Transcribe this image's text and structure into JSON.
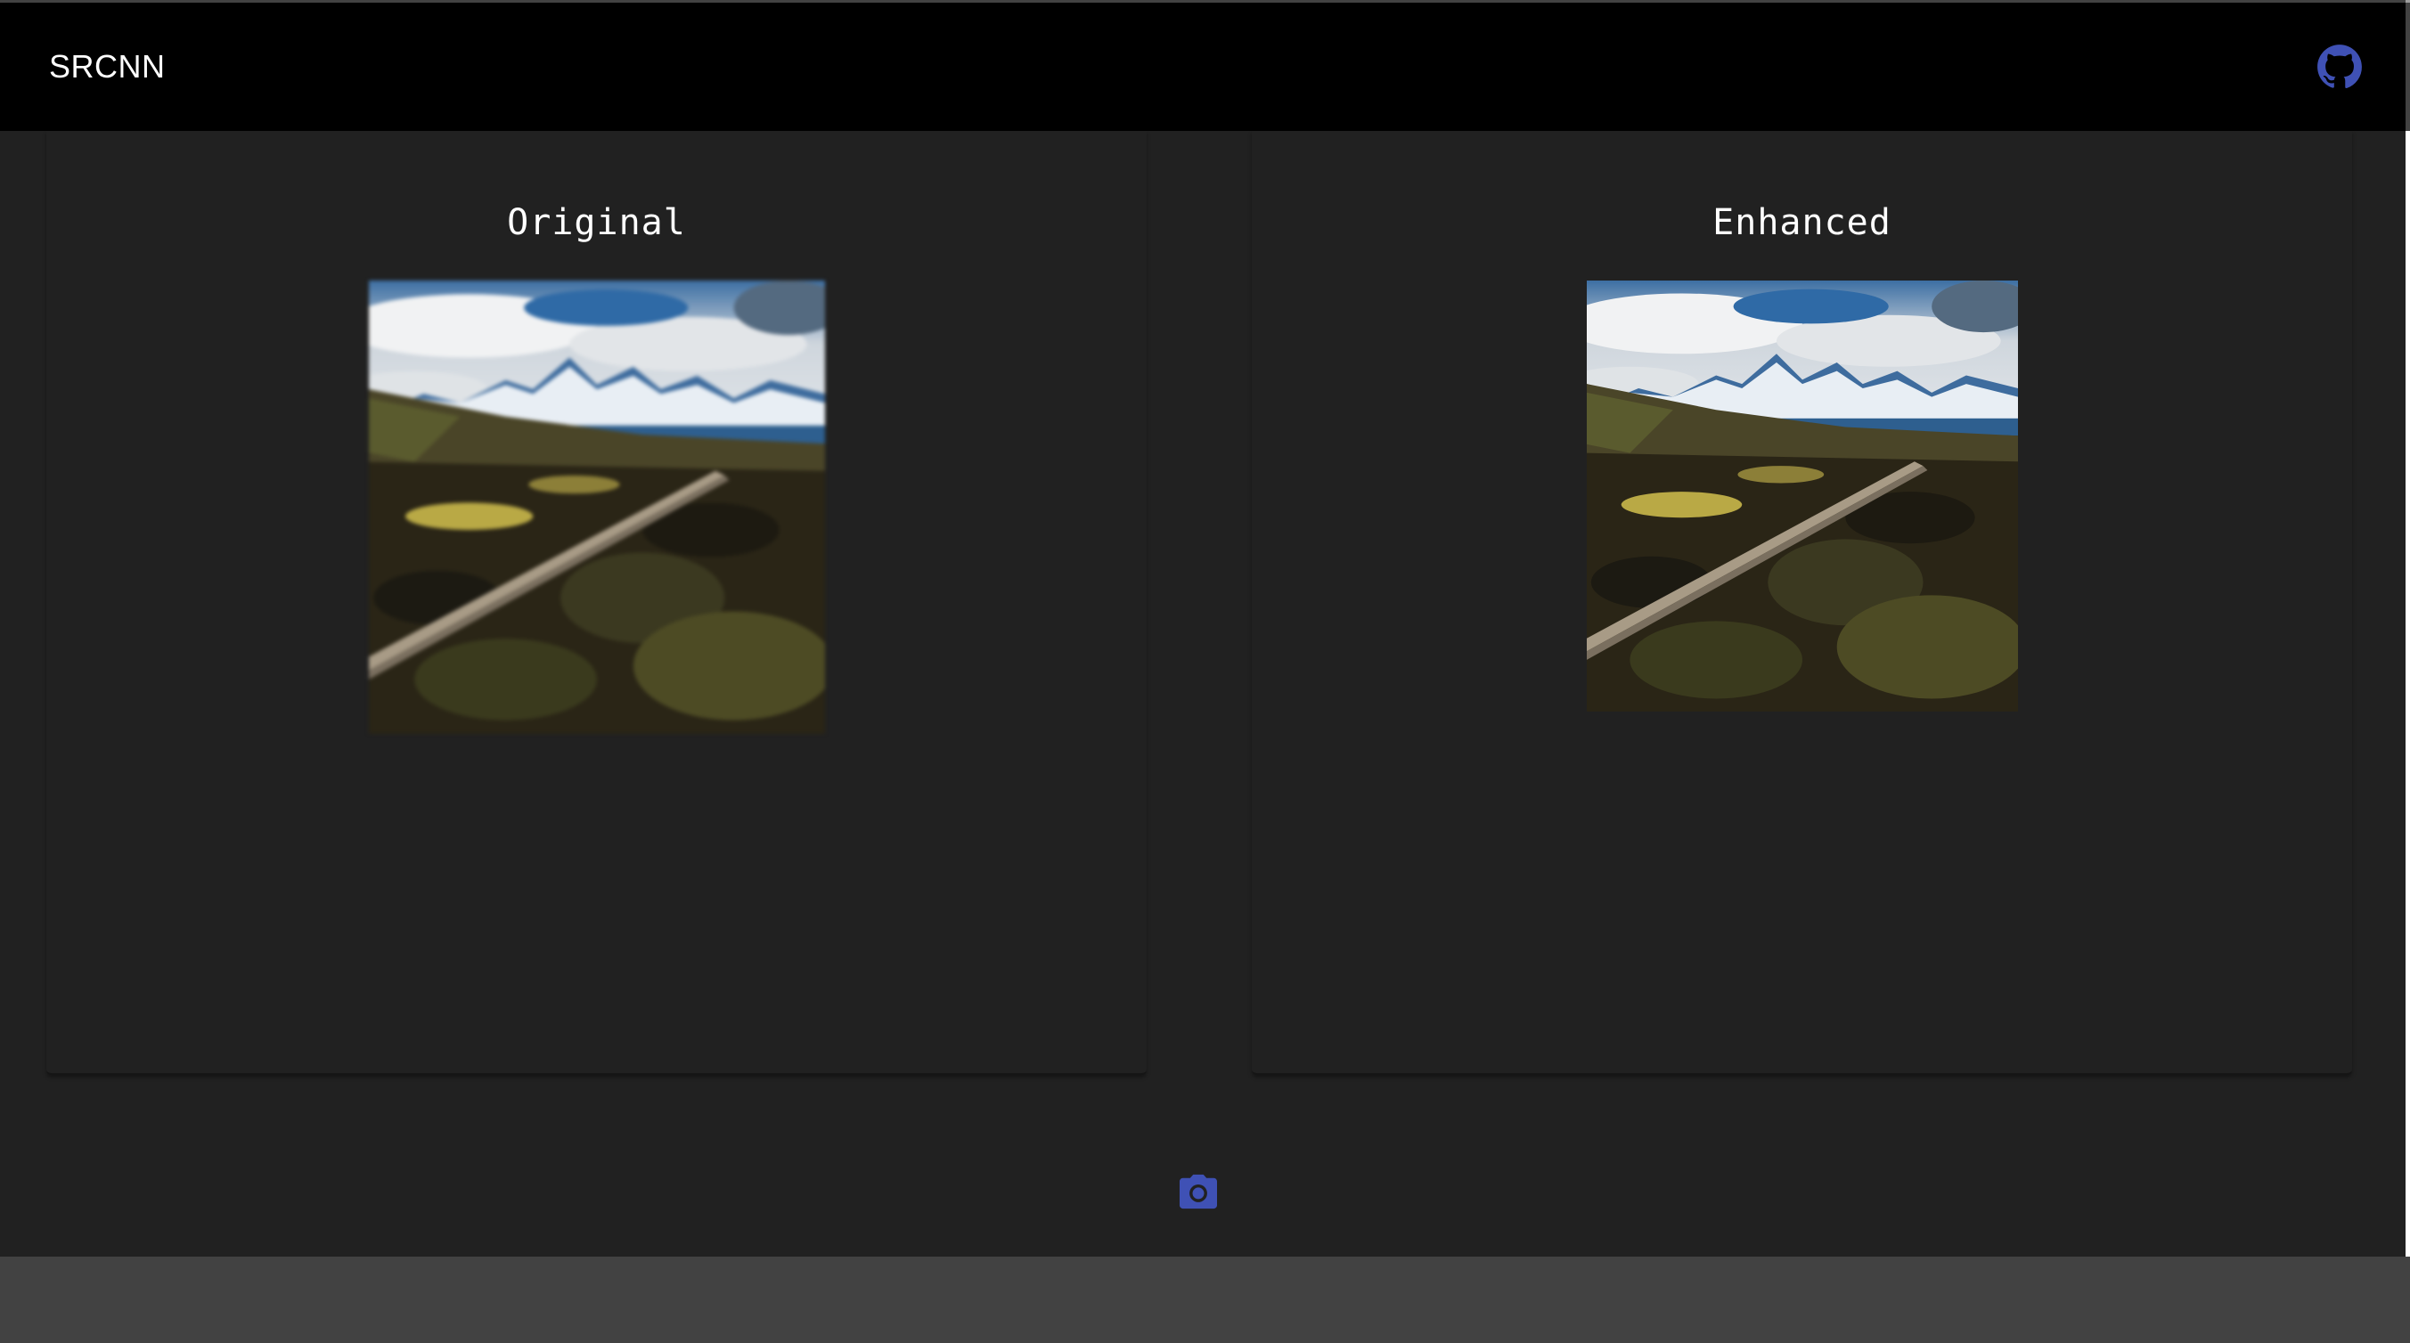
{
  "app": {
    "title": "SRCNN",
    "github_icon": "github-icon",
    "accent_color": "#3f51b5"
  },
  "panels": [
    {
      "title": "Original",
      "image": "landscape-mountain-road-photo"
    },
    {
      "title": "Enhanced",
      "image": "landscape-mountain-road-photo"
    }
  ],
  "actions": {
    "upload_icon": "camera-icon"
  }
}
